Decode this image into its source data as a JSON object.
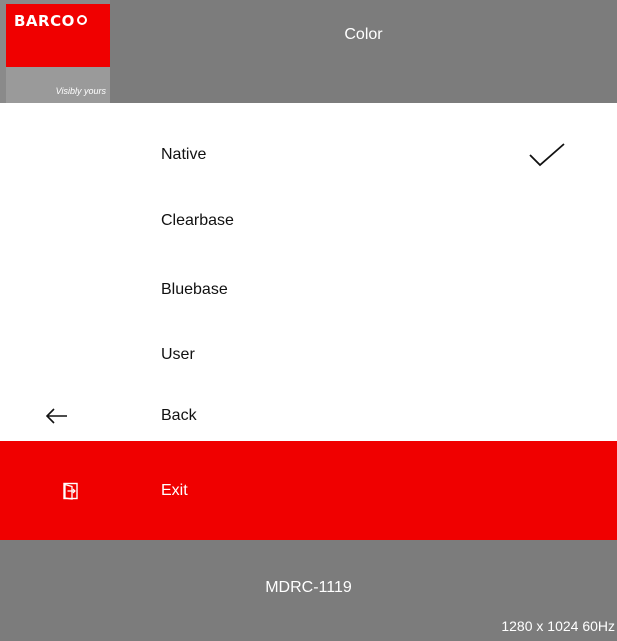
{
  "header": {
    "logo": {
      "brand": "BARCO",
      "tagline": "Visibly yours"
    },
    "title": "Color"
  },
  "menu": {
    "items": [
      {
        "label": "Native",
        "selected": true,
        "icon": "checkmark-icon"
      },
      {
        "label": "Clearbase",
        "selected": false
      },
      {
        "label": "Bluebase",
        "selected": false
      },
      {
        "label": "User",
        "selected": false
      },
      {
        "label": "Back",
        "icon": "arrow-left-icon"
      },
      {
        "label": "Exit",
        "icon": "exit-door-icon",
        "highlighted": true
      }
    ]
  },
  "footer": {
    "model": "MDRC-1119",
    "resolution": "1280 x 1024 60Hz"
  },
  "colors": {
    "bar_gray": "#7c7c7c",
    "highlight_red": "#f00000",
    "background": "#ffffff"
  }
}
